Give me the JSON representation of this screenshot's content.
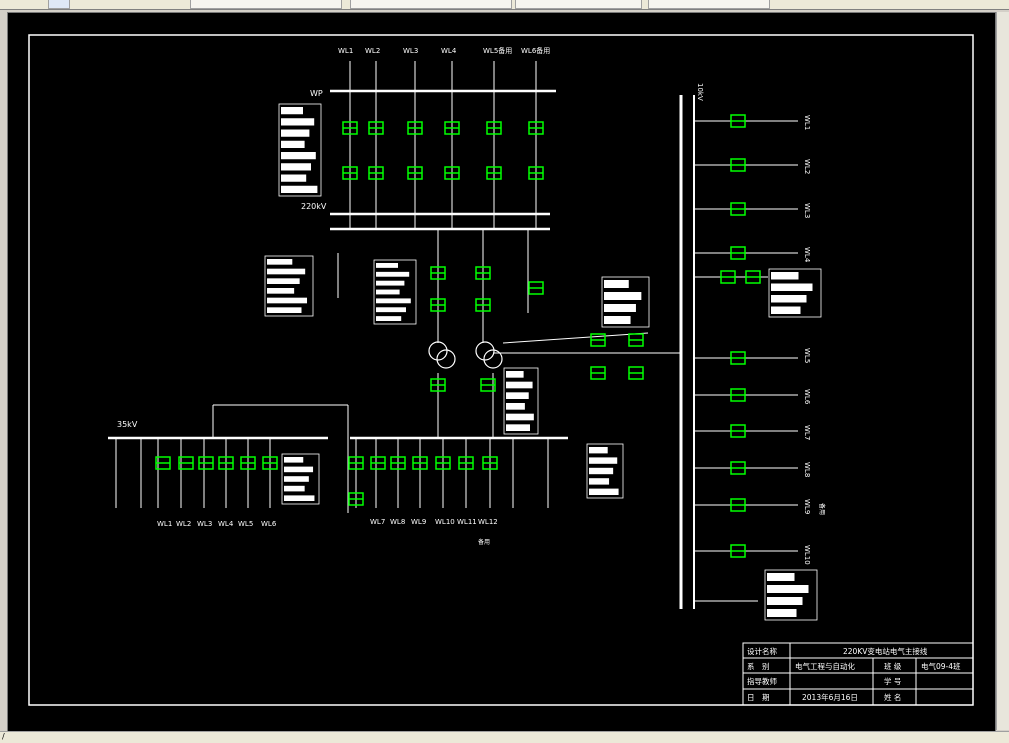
{
  "status_char": "/",
  "busbars": {
    "wp": "WP",
    "kv220": "220kV",
    "kv35": "35kV",
    "kv10": "10kV"
  },
  "feeders_top": [
    "WL1",
    "WL2",
    "WL3",
    "WL4",
    "WL5备用",
    "WL6备用"
  ],
  "feeders_35_left": [
    "WL1",
    "WL2",
    "WL3",
    "WL4",
    "WL5",
    "WL6"
  ],
  "feeders_35_right": [
    "WL7",
    "WL8",
    "WL9",
    "WL10",
    "WL11",
    "WL12"
  ],
  "feeders_10": [
    "WL1",
    "WL2",
    "WL3",
    "WL4",
    "WL5",
    "WL6",
    "WL7",
    "WL8",
    "WL9",
    "WL10"
  ],
  "spare_label": "备用",
  "spare_label_right": "备用",
  "title_block": {
    "r1_label": "设计名称",
    "r1_value": "220KV变电站电气主接线",
    "r2_label": "系　别",
    "r2_value": "电气工程与自动化",
    "r2_label2": "班 级",
    "r2_value2": "电气09-4班",
    "r3_label": "指导教师",
    "r3_label2": "学 号",
    "r4_label": "日　期",
    "r4_value": "2013年6月16日",
    "r4_label2": "姓 名"
  },
  "colors": {
    "background": "#000000",
    "lines": "#ffffff",
    "equipment": "#00ff00"
  }
}
